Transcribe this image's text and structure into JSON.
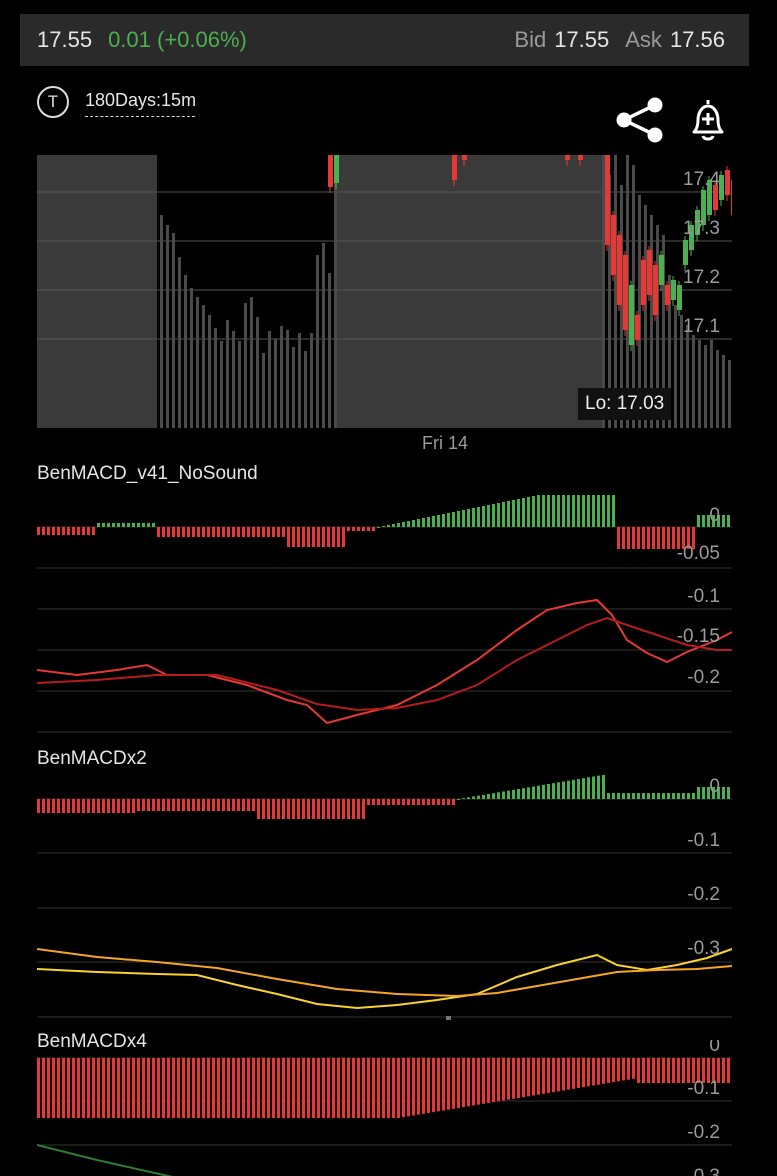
{
  "quote": {
    "last": "17.55",
    "change": "0.01 (+0.06%)",
    "bid_label": "Bid",
    "bid": "17.55",
    "ask_label": "Ask",
    "ask": "17.56",
    "change_color": "#4caf50"
  },
  "toolbar": {
    "ticker_letter": "T",
    "period": "180Days:15m",
    "share_icon": "share-icon",
    "alert_icon": "bell-plus-icon"
  },
  "price_panel": {
    "y_ticks": [
      "17.4",
      "17.3",
      "17.2",
      "17.1"
    ],
    "lo_label": "Lo: 17.03",
    "x_label": "Fri 14",
    "up_color": "#2ea043",
    "down_color": "#e53935"
  },
  "indicators": [
    {
      "title": "BenMACD_v41_NoSound",
      "y_ticks": [
        "0",
        "-0.05",
        "-0.1",
        "-0.15",
        "-0.2"
      ]
    },
    {
      "title": "BenMACDx2",
      "y_ticks": [
        "0",
        "-0.1",
        "-0.2",
        "-0.3"
      ]
    },
    {
      "title": "BenMACDx4",
      "y_ticks": [
        "0",
        "-0.1",
        "-0.2",
        "-0.3"
      ]
    }
  ],
  "chart_data": {
    "type": "line",
    "title": "",
    "series": [],
    "ylim": [
      17.0,
      17.45
    ]
  }
}
